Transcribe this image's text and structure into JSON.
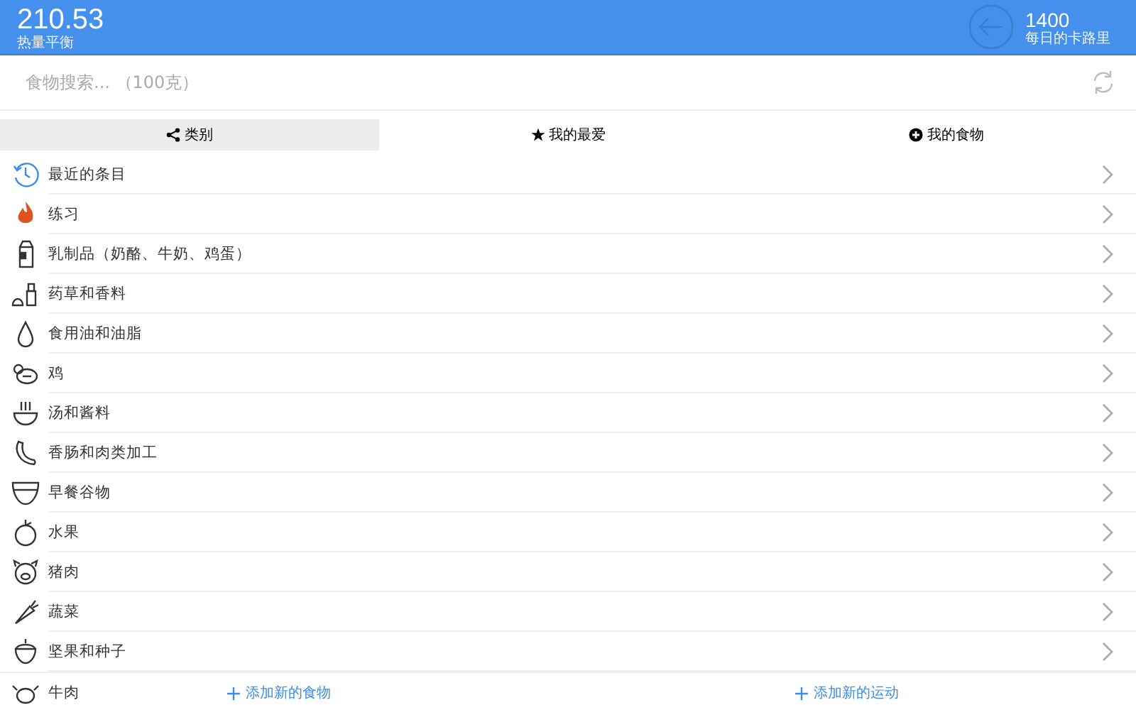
{
  "header": {
    "balance": "210.53",
    "balance_label": "热量平衡",
    "goal": "1400",
    "goal_label": "每日的卡路里"
  },
  "search": {
    "placeholder": "食物搜索... （100克）"
  },
  "tabs": [
    {
      "label": "类别",
      "selected": true
    },
    {
      "label": "我的最爱",
      "selected": false
    },
    {
      "label": "我的食物",
      "selected": false
    }
  ],
  "categories": [
    "最近的条目",
    "练习",
    "乳制品（奶酪、牛奶、鸡蛋）",
    "药草和香料",
    "食用油和油脂",
    "鸡",
    "汤和酱料",
    "香肠和肉类加工",
    "早餐谷物",
    "水果",
    "猪肉",
    "蔬菜",
    "坚果和种子",
    "牛肉"
  ],
  "footer": {
    "add_food": "添加新的食物",
    "add_exercise": "添加新的运动"
  }
}
